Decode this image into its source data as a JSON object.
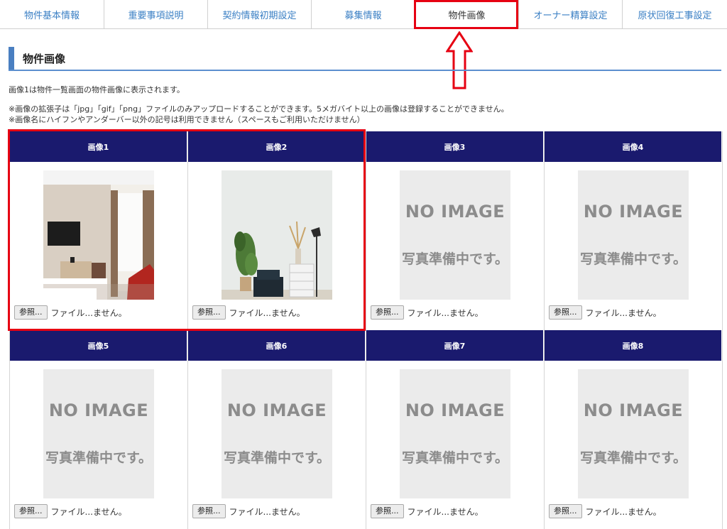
{
  "tabs": [
    {
      "label": "物件基本情報",
      "active": false
    },
    {
      "label": "重要事項説明",
      "active": false
    },
    {
      "label": "契約情報初期設定",
      "active": false
    },
    {
      "label": "募集情報",
      "active": false
    },
    {
      "label": "物件画像",
      "active": true
    },
    {
      "label": "オーナー精算設定",
      "active": false
    },
    {
      "label": "原状回復工事設定",
      "active": false
    }
  ],
  "section": {
    "title": "物件画像"
  },
  "notes": {
    "line1": "画像1は物件一覧画面の物件画像に表示されます。",
    "line2": "※画像の拡張子は「jpg」「gif」「png」ファイルのみアップロードすることができます。5メガバイト以上の画像は登録することができません。",
    "line3": "※画像名にハイフンやアンダーバー以外の記号は利用できません（スペースもご利用いただけません）"
  },
  "no_image": {
    "line1": "NO IMAGE",
    "line2": "写真準備中です。"
  },
  "images": [
    {
      "label": "画像1",
      "has_image": true,
      "browse_label": "参照...",
      "file_status": "ファイル...ません。"
    },
    {
      "label": "画像2",
      "has_image": true,
      "browse_label": "参照...",
      "file_status": "ファイル...ません。"
    },
    {
      "label": "画像3",
      "has_image": false,
      "browse_label": "参照...",
      "file_status": "ファイル...ません。"
    },
    {
      "label": "画像4",
      "has_image": false,
      "browse_label": "参照...",
      "file_status": "ファイル...ません。"
    },
    {
      "label": "画像5",
      "has_image": false,
      "browse_label": "参照...",
      "file_status": "ファイル...ません。"
    },
    {
      "label": "画像6",
      "has_image": false,
      "browse_label": "参照...",
      "file_status": "ファイル...ません。"
    },
    {
      "label": "画像7",
      "has_image": false,
      "browse_label": "参照...",
      "file_status": "ファイル...ません。"
    },
    {
      "label": "画像8",
      "has_image": false,
      "browse_label": "参照...",
      "file_status": "ファイル...ません。"
    }
  ],
  "colors": {
    "tab_text": "#3a7fc4",
    "header_bg": "#1a1a6e",
    "highlight": "#e60012",
    "title_accent": "#4a7fc1"
  }
}
